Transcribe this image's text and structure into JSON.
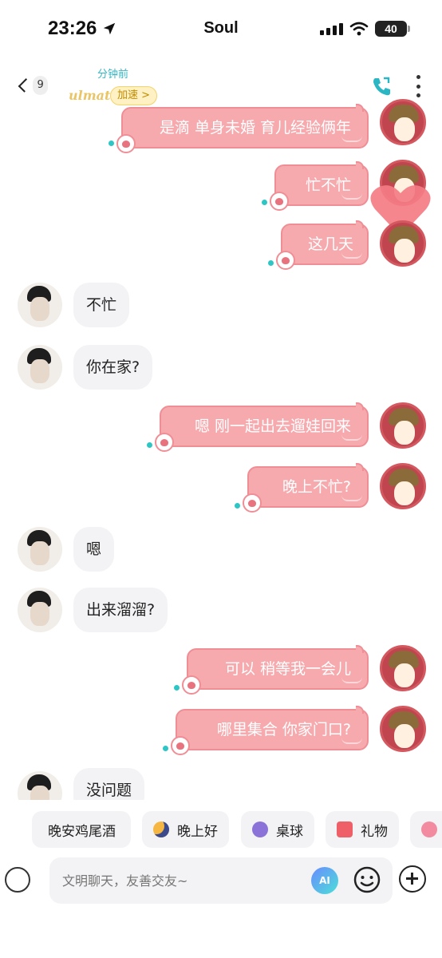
{
  "status_bar": {
    "time": "23:26",
    "app_name": "Soul",
    "battery": "40"
  },
  "header": {
    "unread_count": "9",
    "last_seen": "分钟前",
    "logo_text": "ulmate",
    "speed_badge": "加速 >"
  },
  "messages": [
    {
      "from": "me",
      "text": "是滴 单身未婚 育儿经验俩年"
    },
    {
      "from": "me",
      "text": "忙不忙"
    },
    {
      "from": "me",
      "text": "这几天"
    },
    {
      "from": "other",
      "text": "不忙"
    },
    {
      "from": "other",
      "text": "你在家?"
    },
    {
      "from": "me",
      "text": "嗯 刚一起出去遛娃回来"
    },
    {
      "from": "me",
      "text": "晚上不忙?"
    },
    {
      "from": "other",
      "text": "嗯"
    },
    {
      "from": "other",
      "text": "出来溜溜?"
    },
    {
      "from": "me",
      "text": "可以 稍等我一会儿"
    },
    {
      "from": "me",
      "text": "哪里集合 你家门口?"
    },
    {
      "from": "other",
      "text": "没问题"
    }
  ],
  "quick_replies": [
    {
      "label": "晚安鸡尾酒",
      "icon": "cocktail-icon"
    },
    {
      "label": "晚上好",
      "icon": "moon-icon"
    },
    {
      "label": "桌球",
      "icon": "billiard-icon"
    },
    {
      "label": "礼物",
      "icon": "gift-icon"
    },
    {
      "label": "",
      "icon": "heart-icon"
    }
  ],
  "input": {
    "placeholder": "文明聊天，友善交友~",
    "ai_label": "AI"
  },
  "colors": {
    "bubble_out": "#f6aaae",
    "bubble_out_border": "#f08e96",
    "read_dot": "#2ec5c5",
    "accent_teal": "#35b7c3"
  }
}
